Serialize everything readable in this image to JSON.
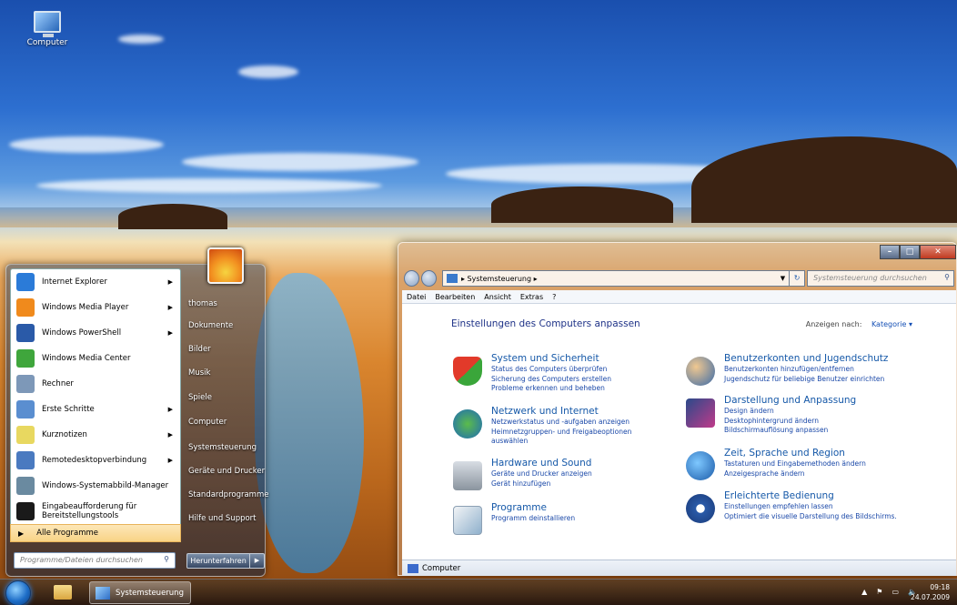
{
  "desktop": {
    "icon_label": "Computer"
  },
  "start_menu": {
    "programs": [
      {
        "label": "Internet Explorer",
        "icon": "internet-explorer-icon",
        "color": "#2b7bd8",
        "submenu": true
      },
      {
        "label": "Windows Media Player",
        "icon": "media-player-icon",
        "color": "#f08a1c",
        "submenu": true
      },
      {
        "label": "Windows PowerShell",
        "icon": "powershell-icon",
        "color": "#2a5aa8",
        "submenu": true
      },
      {
        "label": "Windows Media Center",
        "icon": "media-center-icon",
        "color": "#3fa63c",
        "submenu": false
      },
      {
        "label": "Rechner",
        "icon": "calculator-icon",
        "color": "#7d98b8",
        "submenu": false
      },
      {
        "label": "Erste Schritte",
        "icon": "getting-started-icon",
        "color": "#5a8ed0",
        "submenu": true
      },
      {
        "label": "Kurznotizen",
        "icon": "sticky-notes-icon",
        "color": "#e8d860",
        "submenu": true
      },
      {
        "label": "Remotedesktopverbindung",
        "icon": "remote-desktop-icon",
        "color": "#4a7ac0",
        "submenu": true
      },
      {
        "label": "Windows-Systemabbild-Manager",
        "icon": "system-image-icon",
        "color": "#6a8aa0",
        "submenu": false
      },
      {
        "label_line1": "Eingabeaufforderung für",
        "label_line2": "Bereitstellungstools",
        "icon": "command-prompt-icon",
        "color": "#1a1a1a",
        "submenu": false
      }
    ],
    "all_programs": "Alle Programme",
    "search_placeholder": "Programme/Dateien durchsuchen",
    "right_items": [
      "thomas",
      "Dokumente",
      "Bilder",
      "Musik",
      "Spiele",
      "Computer",
      "Systemsteuerung",
      "Geräte und Drucker",
      "Standardprogramme",
      "Hilfe und Support"
    ],
    "shutdown": "Herunterfahren"
  },
  "window": {
    "address": "Systemsteuerung",
    "search_placeholder": "Systemsteuerung durchsuchen",
    "menu": [
      "Datei",
      "Bearbeiten",
      "Ansicht",
      "Extras",
      "?"
    ],
    "heading": "Einstellungen des Computers anpassen",
    "view_by_label": "Anzeigen nach:",
    "view_by_value": "Kategorie",
    "categories_left": [
      {
        "title": "System und Sicherheit",
        "icon": "shield-icon",
        "links": [
          "Status des Computers überprüfen",
          "Sicherung des Computers erstellen",
          "Probleme erkennen und beheben"
        ]
      },
      {
        "title": "Netzwerk und Internet",
        "icon": "network-globe-icon",
        "links": [
          "Netzwerkstatus und -aufgaben anzeigen",
          "Heimnetzgruppen- und Freigabeoptionen",
          "auswählen"
        ]
      },
      {
        "title": "Hardware und Sound",
        "icon": "printer-icon",
        "links": [
          "Geräte und Drucker anzeigen",
          "Gerät hinzufügen"
        ]
      },
      {
        "title": "Programme",
        "icon": "programs-icon",
        "links": [
          "Programm deinstallieren"
        ]
      }
    ],
    "categories_right": [
      {
        "title": "Benutzerkonten und Jugendschutz",
        "icon": "users-icon",
        "links": [
          "Benutzerkonten hinzufügen/entfernen",
          "Jugendschutz für beliebige Benutzer einrichten"
        ]
      },
      {
        "title": "Darstellung und Anpassung",
        "icon": "appearance-icon",
        "links": [
          "Design ändern",
          "Desktophintergrund ändern",
          "Bildschirmauflösung anpassen"
        ]
      },
      {
        "title": "Zeit, Sprache und Region",
        "icon": "clock-globe-icon",
        "links": [
          "Tastaturen und Eingabemethoden ändern",
          "Anzeigesprache ändern"
        ]
      },
      {
        "title": "Erleichterte Bedienung",
        "icon": "accessibility-icon",
        "links": [
          "Einstellungen empfehlen lassen",
          "Optimiert die visuelle Darstellung des Bildschirms."
        ]
      }
    ],
    "status": "Computer"
  },
  "taskbar": {
    "task_label": "Systemsteuerung",
    "time": "09:18",
    "date": "24.07.2009"
  }
}
